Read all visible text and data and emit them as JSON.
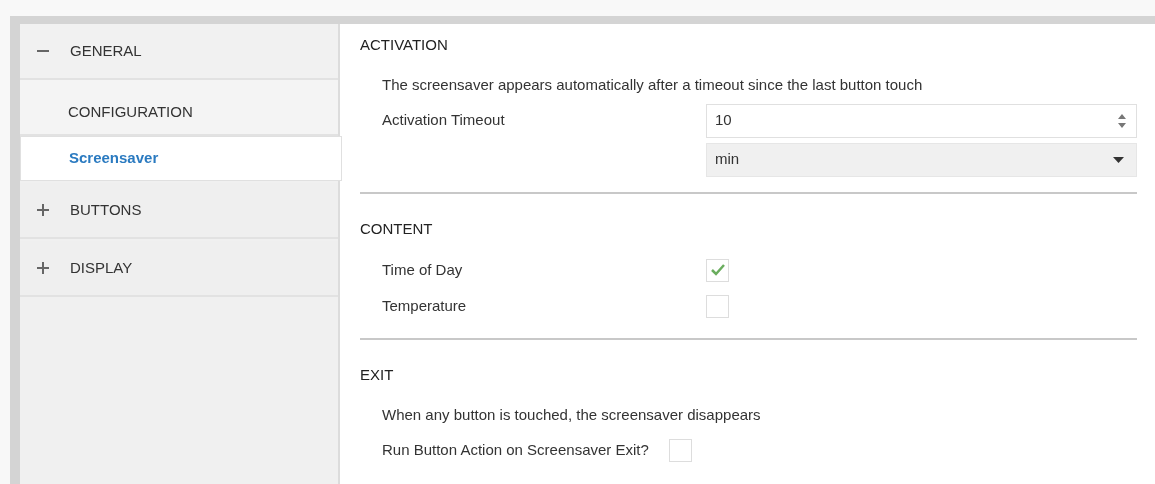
{
  "sidebar": {
    "groups": [
      {
        "label": "GENERAL",
        "expanded": true,
        "children": [
          {
            "label": "CONFIGURATION",
            "selected": false
          },
          {
            "label": "Screensaver",
            "selected": true
          }
        ]
      },
      {
        "label": "BUTTONS",
        "expanded": false
      },
      {
        "label": "DISPLAY",
        "expanded": false
      }
    ]
  },
  "sections": [
    {
      "title": "ACTIVATION",
      "description": "The screensaver appears automatically after a timeout since the last button touch",
      "fields": [
        {
          "kind": "spinbox",
          "label": "Activation Timeout",
          "value": "10"
        },
        {
          "kind": "dropdown",
          "value": "min"
        }
      ]
    },
    {
      "title": "CONTENT",
      "fields": [
        {
          "kind": "checkbox",
          "label": "Time of Day",
          "checked": true
        },
        {
          "kind": "checkbox",
          "label": "Temperature",
          "checked": false
        }
      ]
    },
    {
      "title": "EXIT",
      "description": "When any button is touched, the screensaver disappears",
      "fields": [
        {
          "kind": "checkbox",
          "label": "Run Button Action on Screensaver Exit?",
          "checked": false
        }
      ]
    }
  ]
}
